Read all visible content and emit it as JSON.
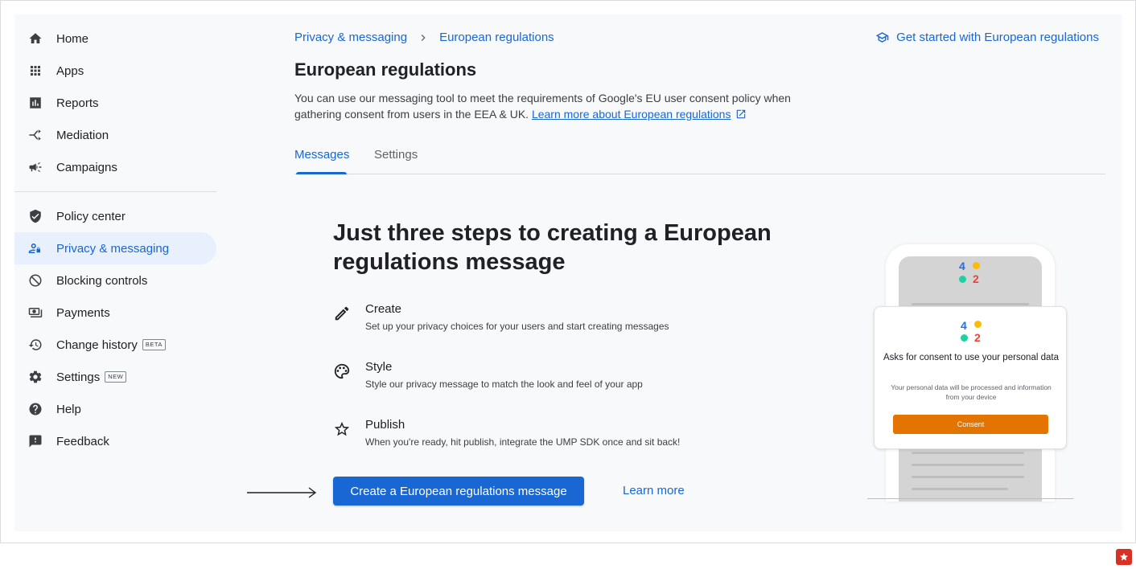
{
  "sidebar": {
    "items": [
      {
        "label": "Home",
        "icon": "home-icon"
      },
      {
        "label": "Apps",
        "icon": "apps-grid-icon"
      },
      {
        "label": "Reports",
        "icon": "reports-icon"
      },
      {
        "label": "Mediation",
        "icon": "mediation-icon"
      },
      {
        "label": "Campaigns",
        "icon": "campaigns-megaphone-icon"
      },
      {
        "label": "Policy center",
        "icon": "shield-check-icon"
      },
      {
        "label": "Privacy & messaging",
        "icon": "privacy-person-icon",
        "active": true
      },
      {
        "label": "Blocking controls",
        "icon": "block-icon"
      },
      {
        "label": "Payments",
        "icon": "payments-icon"
      },
      {
        "label": "Change history",
        "icon": "history-icon",
        "badge": "BETA"
      },
      {
        "label": "Settings",
        "icon": "gear-icon",
        "badge": "NEW"
      },
      {
        "label": "Help",
        "icon": "help-icon"
      },
      {
        "label": "Feedback",
        "icon": "feedback-icon"
      }
    ]
  },
  "breadcrumb": {
    "parent": "Privacy & messaging",
    "current": "European regulations"
  },
  "header": {
    "get_started": "Get started with European regulations",
    "title": "European regulations",
    "description": "You can use our messaging tool to meet the requirements of Google's EU user consent policy when gathering consent from users in the EEA & UK.",
    "learn_more_link": "Learn more about European regulations"
  },
  "tabs": [
    {
      "label": "Messages",
      "active": true
    },
    {
      "label": "Settings",
      "active": false
    }
  ],
  "hero": {
    "title": "Just three steps to creating a European regulations message"
  },
  "steps": [
    {
      "title": "Create",
      "description": "Set up your privacy choices for your users and start creating messages",
      "icon": "pencil-icon"
    },
    {
      "title": "Style",
      "description": "Style our privacy message to match the look and feel of your app",
      "icon": "palette-icon"
    },
    {
      "title": "Publish",
      "description": "When you're ready, hit publish, integrate the UMP SDK once and sit back!",
      "icon": "star-icon"
    }
  ],
  "actions": {
    "primary": "Create a European regulations message",
    "secondary": "Learn more"
  },
  "illustration": {
    "logo_digits": [
      "4",
      "2"
    ],
    "card_title": "Asks for consent to use your personal data",
    "card_subtitle": "Your personal data will be processed and information from your device",
    "card_button": "Consent",
    "colors": {
      "blue": "#1a73e8",
      "yellow": "#fbbc04",
      "green": "#1ed1a0",
      "red": "#ea4335",
      "orange": "#e37400"
    }
  },
  "colors": {
    "accent": "#1967d2",
    "background": "#f8f9fa",
    "active_nav_bg": "#e8f0fe"
  }
}
